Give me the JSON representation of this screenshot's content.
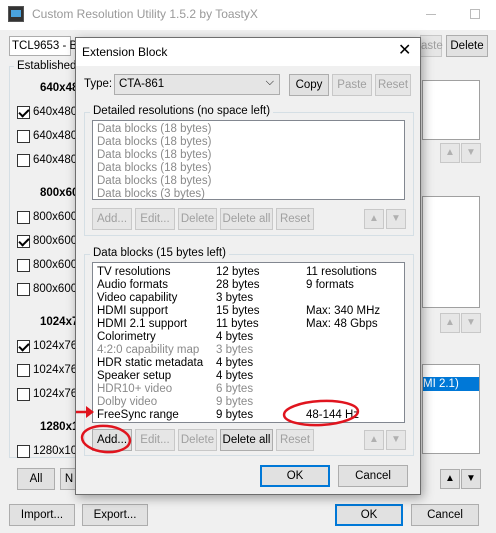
{
  "main": {
    "title": "Custom Resolution Utility 1.5.2 by ToastyX",
    "monitor_label": "TCL9653 - Be",
    "paste_label": "aste",
    "delete_label": "Delete",
    "established_label": "Established",
    "res_640": "640x48",
    "items_640": [
      "640x480",
      "640x480",
      "640x480"
    ],
    "checked_640": [
      true,
      false,
      false
    ],
    "res_800": "800x60",
    "items_800": [
      "800x600",
      "800x600",
      "800x600",
      "800x600"
    ],
    "checked_800": [
      false,
      true,
      false,
      false
    ],
    "res_1024": "1024x7",
    "items_1024": [
      "1024x76",
      "1024x76",
      "1024x76"
    ],
    "checked_1024": [
      true,
      false,
      false
    ],
    "res_1280": "1280x1",
    "items_1280": [
      "1280x10"
    ],
    "all_label": "All",
    "none_label": "N",
    "import_label": "Import...",
    "export_label": "Export...",
    "ok_label": "OK",
    "cancel_label": "Cancel",
    "ext_selected_text": "MI 2.1)"
  },
  "dialog": {
    "title": "Extension Block",
    "type_label": "Type:",
    "type_value": "CTA-861",
    "copy_label": "Copy",
    "paste_label": "Paste",
    "reset_label": "Reset",
    "detailed_group_label": "Detailed resolutions (no space left)",
    "detailed_items": [
      "Data blocks (18 bytes)",
      "Data blocks (18 bytes)",
      "Data blocks (18 bytes)",
      "Data blocks (18 bytes)",
      "Data blocks (18 bytes)",
      "Data blocks (3 bytes)"
    ],
    "data_group_label": "Data blocks (15 bytes left)",
    "data_blocks": [
      {
        "name": "TV resolutions",
        "size": "12 bytes",
        "info": "11 resolutions",
        "enabled": true
      },
      {
        "name": "Audio formats",
        "size": "28 bytes",
        "info": "9 formats",
        "enabled": true
      },
      {
        "name": "Video capability",
        "size": "3 bytes",
        "info": "",
        "enabled": true
      },
      {
        "name": "HDMI support",
        "size": "15 bytes",
        "info": "Max: 340 MHz",
        "enabled": true
      },
      {
        "name": "HDMI 2.1 support",
        "size": "11 bytes",
        "info": "Max: 48 Gbps",
        "enabled": true
      },
      {
        "name": "Colorimetry",
        "size": "4 bytes",
        "info": "",
        "enabled": true
      },
      {
        "name": "4:2:0 capability map",
        "size": "3 bytes",
        "info": "",
        "enabled": false
      },
      {
        "name": "HDR static metadata",
        "size": "4 bytes",
        "info": "",
        "enabled": true
      },
      {
        "name": "Speaker setup",
        "size": "4 bytes",
        "info": "",
        "enabled": true
      },
      {
        "name": "HDR10+ video",
        "size": "6 bytes",
        "info": "",
        "enabled": false
      },
      {
        "name": "Dolby video",
        "size": "9 bytes",
        "info": "",
        "enabled": false
      },
      {
        "name": "FreeSync range",
        "size": "9 bytes",
        "info": "48-144 Hz",
        "enabled": true
      }
    ],
    "add_label": "Add...",
    "edit_label": "Edit...",
    "delete_label": "Delete",
    "delete_all_label": "Delete all",
    "ok_label": "OK",
    "cancel_label": "Cancel"
  },
  "colors": {
    "annotation_red": "#e0141e",
    "accent_blue": "#0078d7",
    "selection_blue": "#0078d7"
  }
}
